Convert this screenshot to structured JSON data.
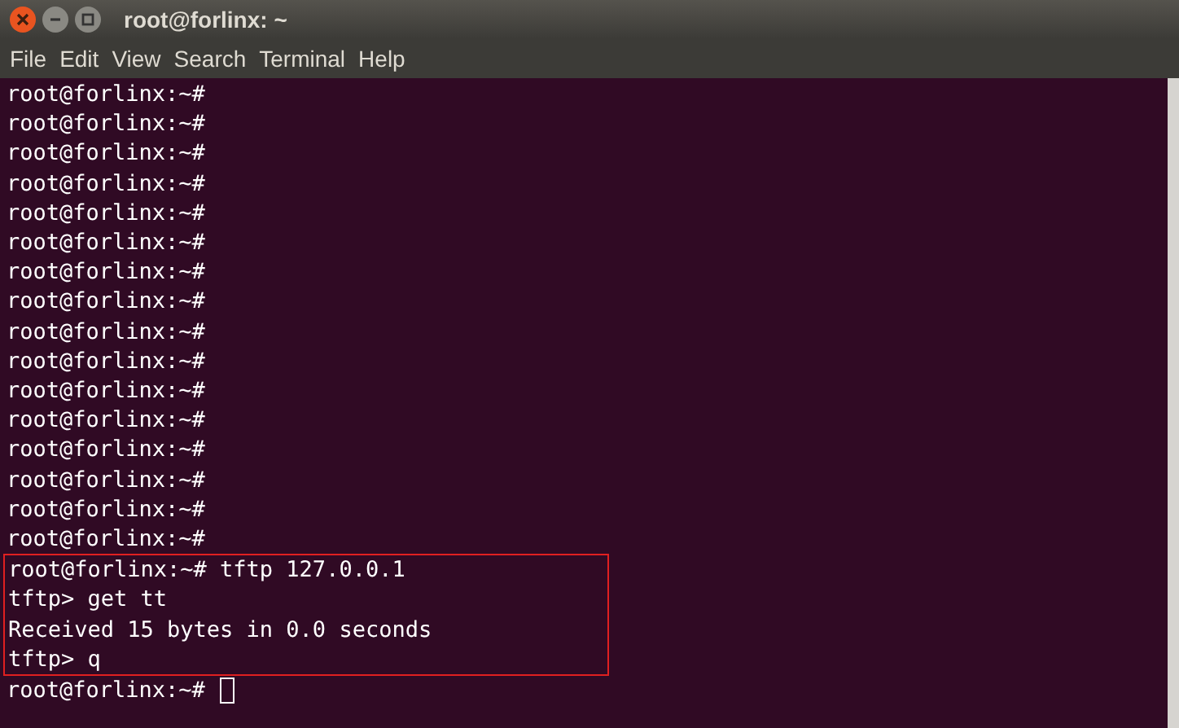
{
  "window": {
    "title": "root@forlinx: ~"
  },
  "menu": [
    "File",
    "Edit",
    "View",
    "Search",
    "Terminal",
    "Help"
  ],
  "terminal": {
    "lines": [
      "root@forlinx:~#",
      "root@forlinx:~#",
      "root@forlinx:~#",
      "root@forlinx:~#",
      "root@forlinx:~#",
      "root@forlinx:~#",
      "root@forlinx:~#",
      "root@forlinx:~#",
      "root@forlinx:~#",
      "root@forlinx:~#",
      "root@forlinx:~#",
      "root@forlinx:~#",
      "root@forlinx:~#",
      "root@forlinx:~#",
      "root@forlinx:~#",
      "root@forlinx:~#"
    ],
    "highlighted_lines": [
      "root@forlinx:~# tftp 127.0.0.1",
      "tftp> get tt",
      "Received 15 bytes in 0.0 seconds",
      "tftp> q"
    ],
    "prompt": "root@forlinx:~#"
  }
}
